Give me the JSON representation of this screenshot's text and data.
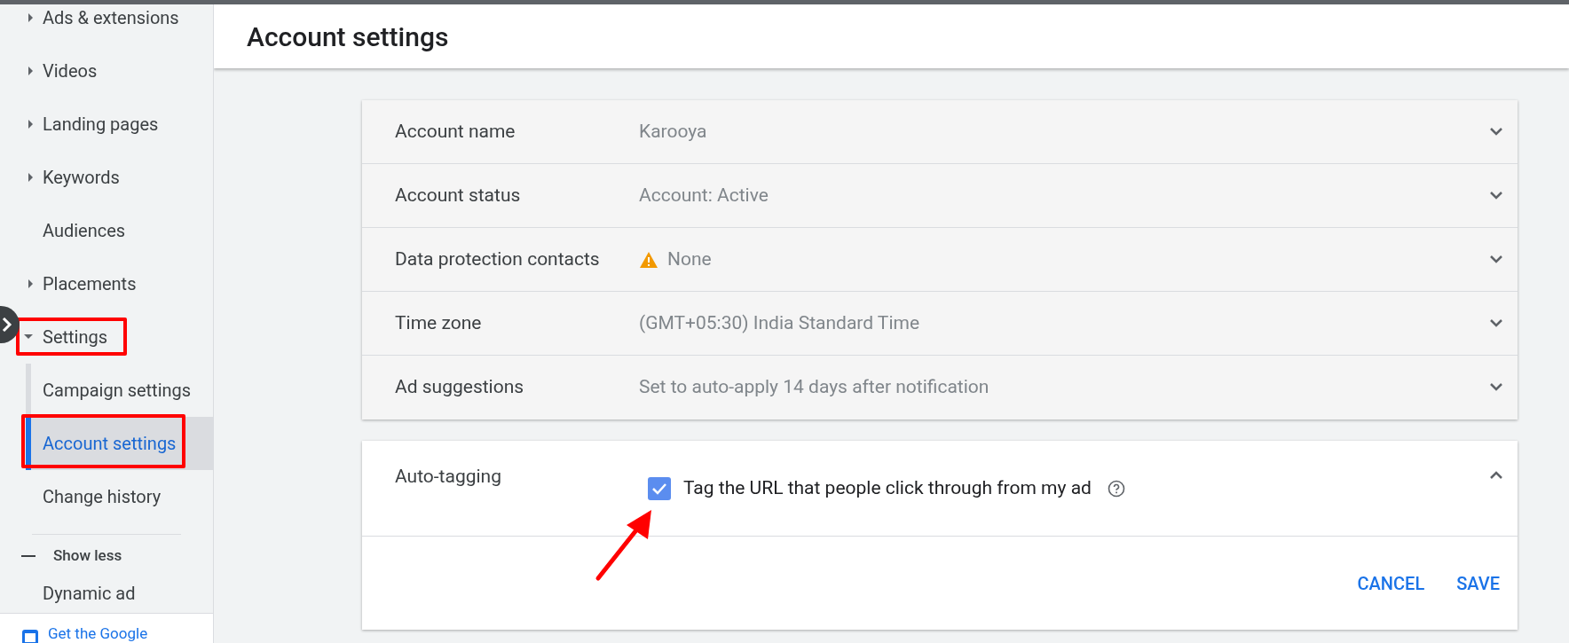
{
  "sidebar": {
    "items": [
      {
        "label": "Ads & extensions",
        "kind": "expandable",
        "expanded": false,
        "highlighted": false
      },
      {
        "label": "Videos",
        "kind": "expandable",
        "expanded": false,
        "highlighted": false
      },
      {
        "label": "Landing pages",
        "kind": "expandable",
        "expanded": false,
        "highlighted": false
      },
      {
        "label": "Keywords",
        "kind": "expandable",
        "expanded": false,
        "highlighted": false
      },
      {
        "label": "Audiences",
        "kind": "plain",
        "highlighted": false
      },
      {
        "label": "Placements",
        "kind": "expandable",
        "expanded": false,
        "highlighted": false
      },
      {
        "label": "Settings",
        "kind": "expandable",
        "expanded": true,
        "highlighted": true,
        "children": [
          {
            "label": "Campaign settings",
            "selected": false,
            "highlighted": false
          },
          {
            "label": "Account settings",
            "selected": true,
            "highlighted": true
          },
          {
            "label": "Change history",
            "selected": false,
            "highlighted": false
          }
        ]
      }
    ],
    "show_less": "Show less",
    "more_item": "Dynamic ad",
    "footer_link": "Get the Google"
  },
  "page_title": "Account settings",
  "settings_rows": [
    {
      "label": "Account name",
      "value": "Karooya",
      "warning": false,
      "expanded": false
    },
    {
      "label": "Account status",
      "value": "Account: Active",
      "warning": false,
      "expanded": false
    },
    {
      "label": "Data protection contacts",
      "value": "None",
      "warning": true,
      "expanded": false
    },
    {
      "label": "Time zone",
      "value": "(GMT+05:30) India Standard Time",
      "warning": false,
      "expanded": false
    },
    {
      "label": "Ad suggestions",
      "value": "Set to auto-apply 14 days after notification",
      "warning": false,
      "expanded": false
    }
  ],
  "auto_tagging": {
    "label": "Auto-tagging",
    "expanded": true,
    "checkbox": {
      "label": "Tag the URL that people click through from my ad",
      "checked": true
    },
    "buttons": [
      "CANCEL",
      "SAVE"
    ]
  }
}
